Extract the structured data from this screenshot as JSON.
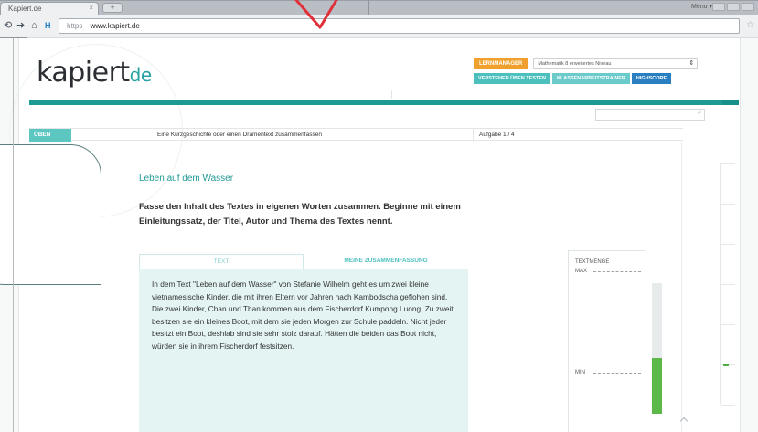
{
  "browser": {
    "tab_title": "Kapiert.de",
    "tab_close": "×",
    "new_tab": "+",
    "menu_label": "Menu ▾",
    "url_scheme": "https",
    "url": "www.kapiert.de"
  },
  "site": {
    "logo_main": "kapiert",
    "logo_suffix": "de",
    "lernmanager_label": "LERNMANAGER",
    "lernmanager_select": "Mathematik 8 erweitertes Niveau",
    "nav": [
      {
        "label": "VERSTEHEN ÜBEN TESTEN"
      },
      {
        "label": "KLASSENARBEITSTRAINER"
      },
      {
        "label": "HIGHSCORE"
      }
    ]
  },
  "task": {
    "section_tab": "ÜBEN",
    "title": "Eine Kurzgeschichte oder einen Dramentext zusammenfassen",
    "counter": "Aufgabe 1 / 4",
    "heading": "Leben auf dem Wasser",
    "instruction": "Fasse den Inhalt des Textes in eigenen Worten zusammen. Beginne mit einem Einleitungssatz, der Titel, Autor und Thema des Textes nennt.",
    "tab_text": "TEXT",
    "tab_summary": "MEINE ZUSAMMENFASSUNG",
    "summary_body": "In dem Text \"Leben auf dem Wasser\" von Stefanie Wilhelm geht es um zwei kleine vietnamesische Kinder, die mit ihren Eltern vor Jahren nach Kambodscha geflohen sind. Die zwei Kinder, Chan und Than kommen aus dem Fischerdorf Kumpong Luong. Zu zweit besitzen sie ein kleines Boot, mit dem sie jeden Morgen zur Schule paddeln. Nicht jeder besitzt ein Boot, deshlab sind sie sehr stolz darauf. Hätten die beiden das Boot nicht, würden sie in ihrem Fischerdorf festsitzen."
  },
  "meter": {
    "title": "TEXTMENGE",
    "max_label": "MAX",
    "min_label": "MIN",
    "fill_fraction": 0.43,
    "fill_color": "#5db84a"
  },
  "icons": {
    "back": "back-arrow-icon",
    "forward": "forward-arrow-icon",
    "home": "home-icon",
    "bookmark": "star-icon",
    "search": "magnifier-icon",
    "dropdown": "chevron-updown-icon"
  },
  "colors": {
    "brand_teal": "#1c9b94",
    "lernmanager_orange": "#f0a02c",
    "highscore_blue": "#2a7fc0",
    "accent_red": "#e0303a"
  }
}
